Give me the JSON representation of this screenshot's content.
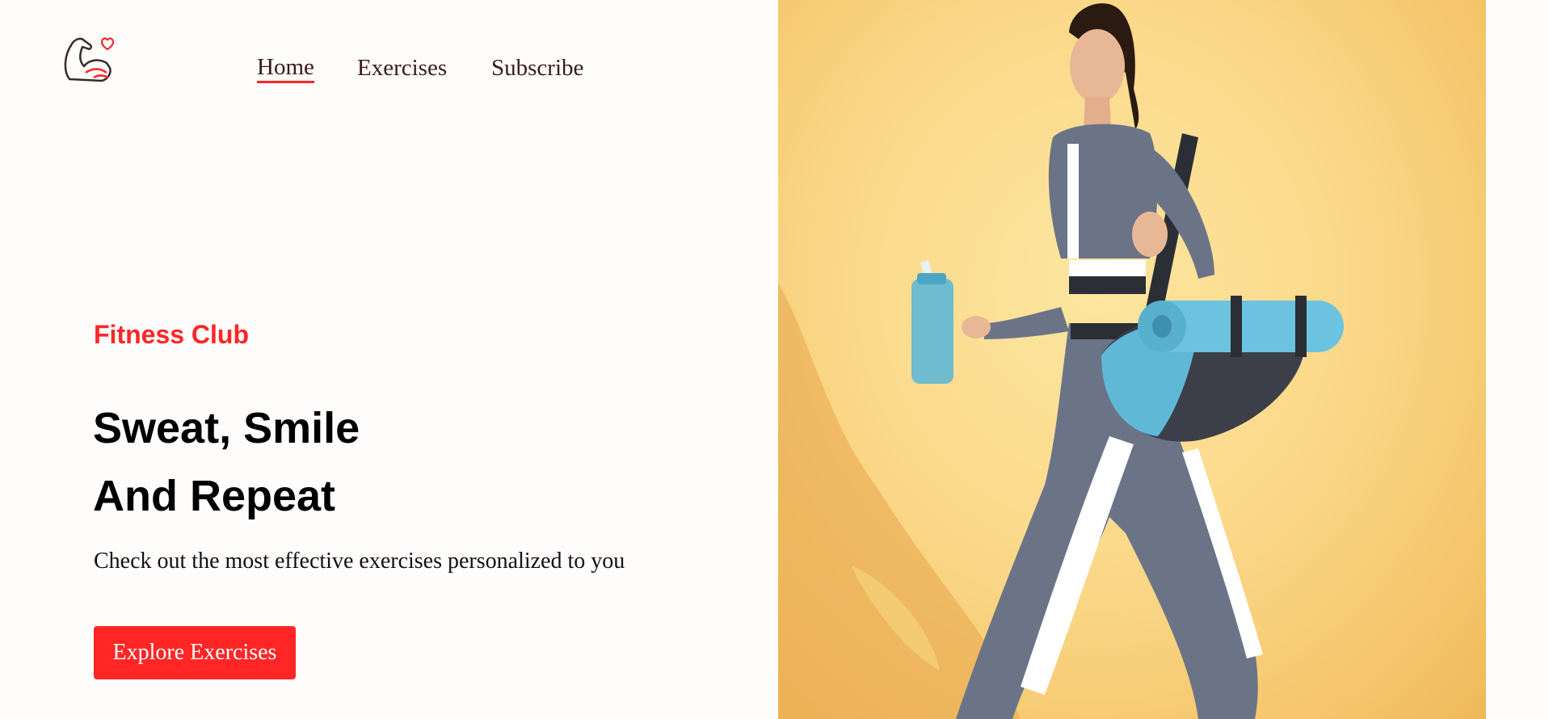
{
  "nav": {
    "items": [
      {
        "label": "Home",
        "active": true
      },
      {
        "label": "Exercises",
        "active": false
      },
      {
        "label": "Subscribe",
        "active": false
      }
    ]
  },
  "hero": {
    "brand": "Fitness Club",
    "headline_line1": "Sweat, Smile",
    "headline_line2": "And Repeat",
    "subtitle": "Check out the most effective exercises personalized to you",
    "cta_label": "Explore Exercises"
  },
  "colors": {
    "accent": "#ff2625",
    "hero_background": "#fbd98a",
    "page_background": "#fffcfc"
  },
  "icons": {
    "logo": "flexed-arm-heart-icon"
  }
}
